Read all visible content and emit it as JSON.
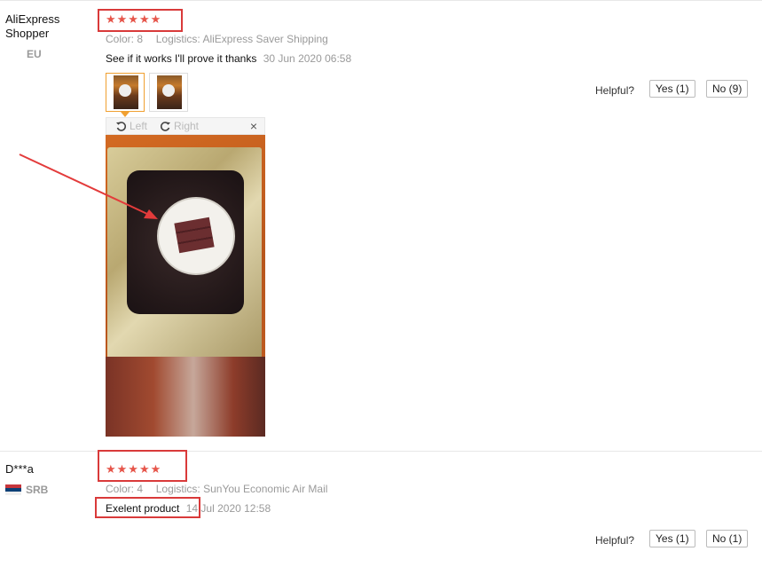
{
  "reviews": [
    {
      "user": "AliExpress Shopper",
      "country": "EU",
      "stars": "★★★★★",
      "color_label": "Color:",
      "color_value": "8",
      "logistics_label": "Logistics:",
      "logistics_value": "AliExpress Saver Shipping",
      "text": "See if it works I'll prove it thanks",
      "date": "30 Jun 2020 06:58",
      "helpful_label": "Helpful?",
      "yes_label": "Yes (1)",
      "no_label": "No (9)",
      "viewer": {
        "left_label": "Left",
        "right_label": "Right",
        "close": "×"
      }
    },
    {
      "user": "D***a",
      "country": "SRB",
      "stars": "★★★★★",
      "color_label": "Color:",
      "color_value": "4",
      "logistics_label": "Logistics:",
      "logistics_value": "SunYou Economic Air Mail",
      "text": "Exelent product",
      "date": "14 Jul 2020 12:58",
      "helpful_label": "Helpful?",
      "yes_label": "Yes (1)",
      "no_label": "No (1)"
    }
  ],
  "colors": {
    "annotation_red": "#d93a3a",
    "star": "#e6554a",
    "thumb_active": "#f0a030"
  },
  "icons": [
    "rotate-left-icon",
    "rotate-right-icon",
    "close-icon",
    "flag-serbia-icon"
  ]
}
